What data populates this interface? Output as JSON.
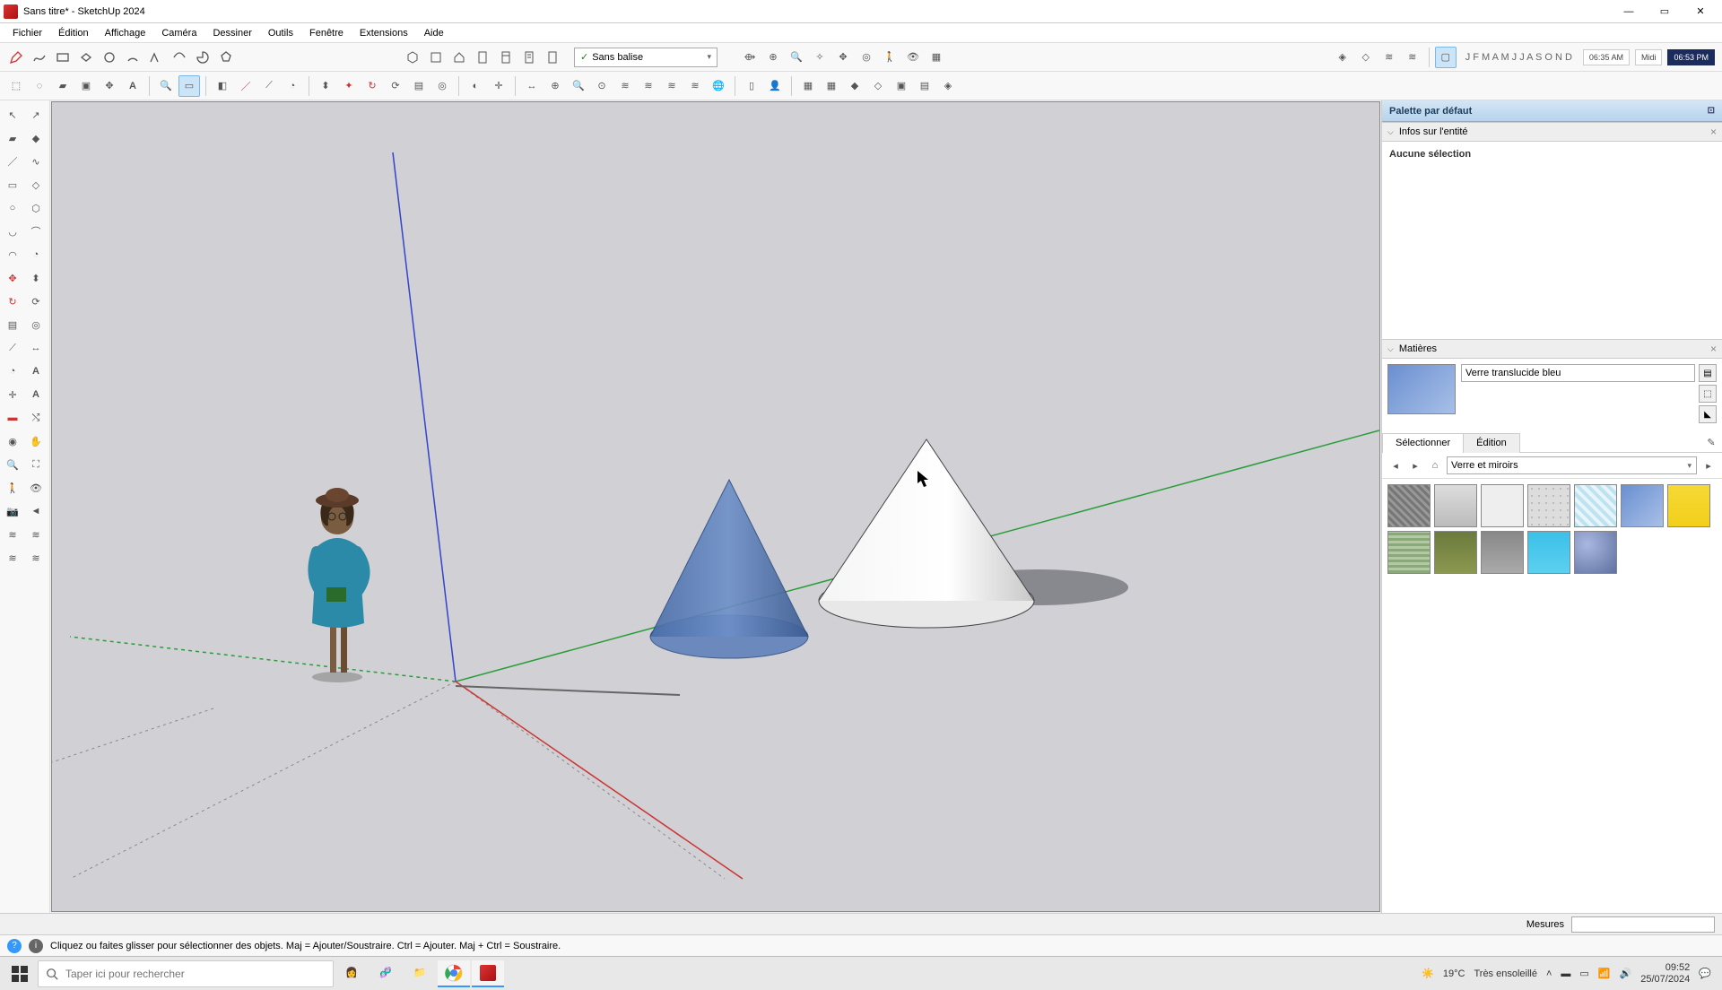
{
  "window": {
    "title": "Sans titre* - SketchUp 2024"
  },
  "menu": [
    "Fichier",
    "Édition",
    "Affichage",
    "Caméra",
    "Dessiner",
    "Outils",
    "Fenêtre",
    "Extensions",
    "Aide"
  ],
  "tag_dropdown": {
    "checked": true,
    "label": "Sans balise"
  },
  "months": "J F M A M J J A S O N D",
  "times": {
    "left": "06:35 AM",
    "mid": "Midi",
    "right": "06:53 PM"
  },
  "tray": {
    "title": "Palette par défaut",
    "entity_panel": {
      "title": "Infos sur l'entité",
      "none": "Aucune sélection"
    },
    "materials_panel": {
      "title": "Matières",
      "current_name": "Verre translucide bleu",
      "tab_select": "Sélectionner",
      "tab_edit": "Édition",
      "category": "Verre et miroirs"
    }
  },
  "swatches": [
    "repeating-linear-gradient(45deg,#777,#777 3px,#999 3px,#999 6px)",
    "linear-gradient(#ddd,#bbb)",
    "linear-gradient(#eee,#eee)",
    "radial-gradient(#bbb 20%,#ddd 21%) 0 0/8px 8px",
    "repeating-linear-gradient(45deg,#bde3f0,#bde3f0 4px,#e8f5fb 4px,#e8f5fb 8px)",
    "linear-gradient(135deg,#6a8fd0,#a8c0e8)",
    "linear-gradient(#f5d935,#f2cf1a)",
    "repeating-linear-gradient(0deg,#8aa87a 0 3px,#b5c8a5 3px 6px)",
    "linear-gradient(#6c7a3c,#8a9850)",
    "linear-gradient(#888,#aaa)",
    "linear-gradient(#3ac0e8,#5dd0f0)",
    "radial-gradient(circle at 30% 30%,#a8b8e0,#6070a0)"
  ],
  "measure_label": "Mesures",
  "status": {
    "hint": "Cliquez ou faites glisser pour sélectionner des objets. Maj = Ajouter/Soustraire. Ctrl = Ajouter. Maj + Ctrl = Soustraire."
  },
  "taskbar": {
    "search_placeholder": "Taper ici pour rechercher",
    "weather_temp": "19°C",
    "weather_desc": "Très ensoleillé",
    "time": "09:52",
    "date": "25/07/2024"
  }
}
